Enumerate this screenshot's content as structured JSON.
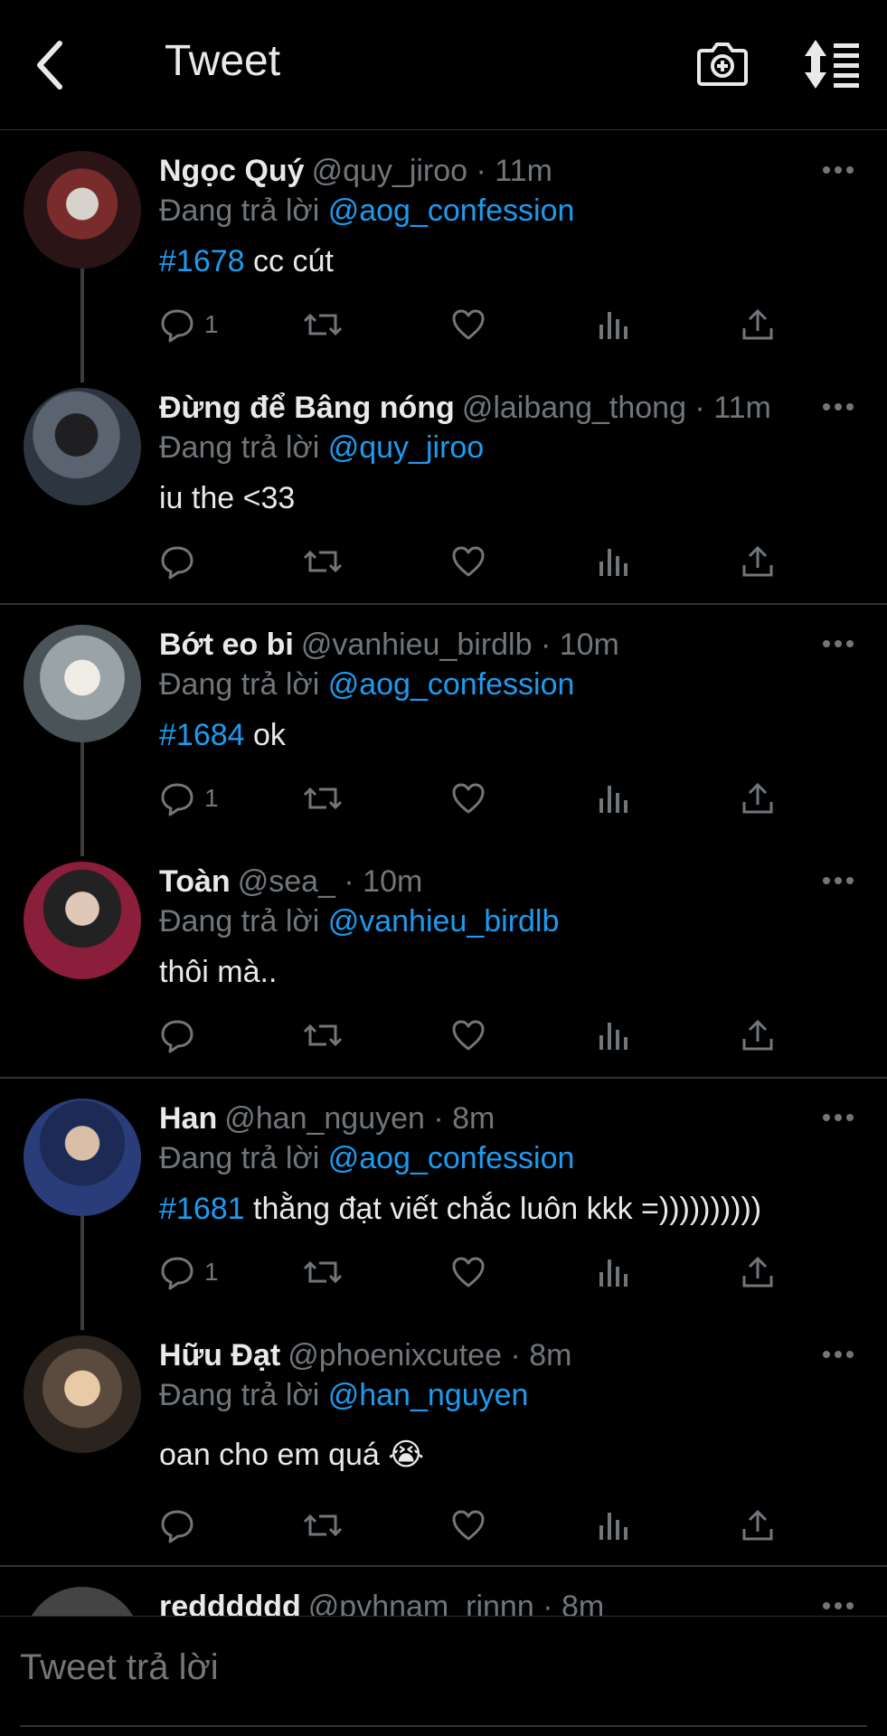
{
  "header": {
    "title": "Tweet"
  },
  "replying_prefix": "Đang trả lời",
  "tweets": [
    {
      "name": "Ngọc Quý",
      "handle": "@quy_jiroo · 11m",
      "reply_to": "@aog_confession",
      "hashtag": "#1678",
      "text": " cc cút",
      "reply_count": "1",
      "avatar_color": "#7a2b2b"
    },
    {
      "name": "Đừng để Bâng nóng",
      "handle": "@laibang_thong · 11m",
      "reply_to": "@quy_jiroo",
      "hashtag": "",
      "text": "iu the <33",
      "reply_count": "",
      "avatar_color": "#3b4654"
    },
    {
      "name": "Bớt eo bi",
      "handle": "@vanhieu_birdlb · 10m",
      "reply_to": "@aog_confession",
      "hashtag": "#1684",
      "text": " ok",
      "reply_count": "1",
      "avatar_color": "#9aa3a8"
    },
    {
      "name": "Toàn",
      "handle": "@sea_ · 10m",
      "reply_to": "@vanhieu_birdlb",
      "hashtag": "",
      "text": "thôi mà..",
      "reply_count": "",
      "avatar_color": "#8b1e3a"
    },
    {
      "name": "Han",
      "handle": "@han_nguyen · 8m",
      "reply_to": "@aog_confession",
      "hashtag": "#1681",
      "text": " thằng đạt viết chắc luôn kkk =))))))))))",
      "reply_count": "1",
      "avatar_color": "#2a3c7a"
    },
    {
      "name": "Hữu Đạt",
      "handle": "@phoenixcutee · 8m",
      "reply_to": "@han_nguyen",
      "hashtag": "",
      "text": "oan cho em quá 😭",
      "reply_count": "",
      "avatar_color": "#5b4a3e"
    },
    {
      "name": "redddddd",
      "handle": "@pvhnam_rinnn · 8m",
      "reply_to": "",
      "hashtag": "",
      "text": "",
      "reply_count": "",
      "avatar_color": "#444"
    }
  ],
  "compose": {
    "placeholder": "Tweet trả lời"
  },
  "colors": {
    "accent": "#1d9bf0",
    "muted": "#71767b",
    "background": "#000000"
  }
}
